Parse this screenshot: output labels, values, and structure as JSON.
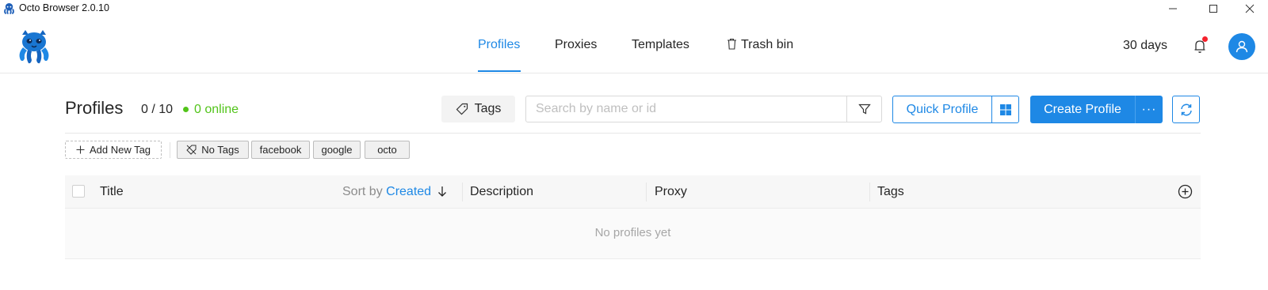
{
  "window": {
    "title": "Octo Browser 2.0.10"
  },
  "nav": {
    "items": [
      {
        "label": "Profiles",
        "active": true
      },
      {
        "label": "Proxies",
        "active": false
      },
      {
        "label": "Templates",
        "active": false
      },
      {
        "label": "Trash bin",
        "active": false,
        "icon": "trash-icon"
      }
    ]
  },
  "header": {
    "subscription_days": "30 days",
    "notification_icon": "bell-icon",
    "notification_unread": true,
    "user_icon": "user-icon"
  },
  "toolbar": {
    "page_title": "Profiles",
    "profile_count": "0 / 10",
    "online_label": "0 online",
    "tags_button": "Tags",
    "search_placeholder": "Search by name or id",
    "quick_profile_button": "Quick Profile",
    "os_icon": "windows-icon",
    "create_profile_button": "Create Profile",
    "more_button": "···"
  },
  "tags": {
    "add_new_label": "Add New Tag",
    "no_tags_label": "No Tags",
    "chips": [
      "facebook",
      "google",
      "octo"
    ]
  },
  "table": {
    "columns": {
      "title": "Title",
      "sort_by_label": "Sort by",
      "sort_value": "Created",
      "description": "Description",
      "proxy": "Proxy",
      "tags": "Tags"
    },
    "empty_text": "No profiles yet"
  },
  "colors": {
    "accent": "#1e88e5",
    "online": "#52c41a",
    "notification_dot": "#f5222d"
  }
}
